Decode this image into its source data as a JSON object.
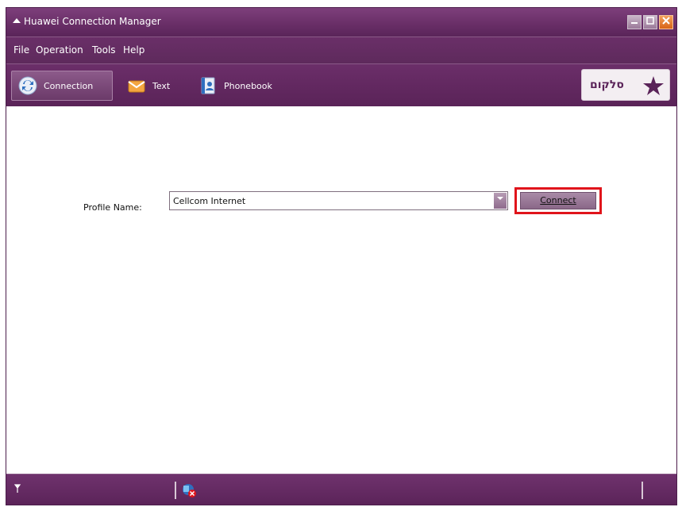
{
  "window": {
    "title": "Huawei Connection Manager"
  },
  "menu": {
    "items": [
      "File",
      "Operation",
      "Tools",
      "Help"
    ]
  },
  "toolbar": {
    "tabs": [
      {
        "label": "Connection",
        "icon": "connection-icon"
      },
      {
        "label": "Text",
        "icon": "envelope-icon"
      },
      {
        "label": "Phonebook",
        "icon": "phonebook-icon"
      }
    ],
    "logo_text": "סלקום"
  },
  "main": {
    "profile_label": "Profile Name:",
    "profile_value": "Cellcom Internet",
    "connect_label": "Connect"
  },
  "colors": {
    "accent": "#6a2f68",
    "highlight": "#e0141b"
  }
}
